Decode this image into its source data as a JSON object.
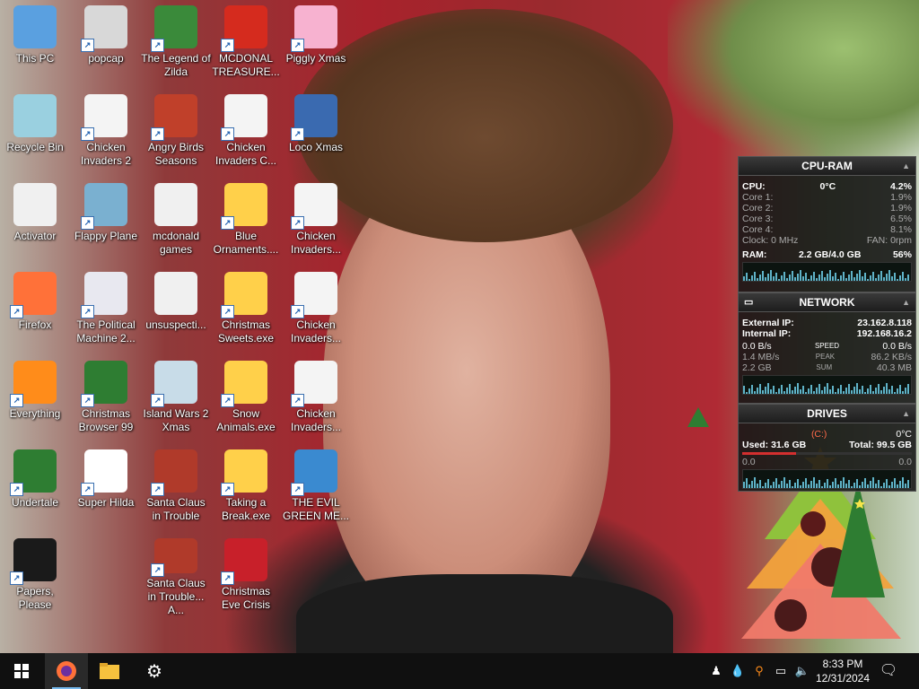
{
  "desktop": {
    "icons": [
      {
        "label": "This PC",
        "icon": "computer-icon"
      },
      {
        "label": "Recycle Bin",
        "icon": "recycle-bin-icon"
      },
      {
        "label": "Activator",
        "icon": "file-icon"
      },
      {
        "label": "Firefox",
        "icon": "firefox-icon"
      },
      {
        "label": "Everything",
        "icon": "everything-search-icon"
      },
      {
        "label": "Undertale",
        "icon": "undertale-icon"
      },
      {
        "label": "Papers, Please",
        "icon": "papers-please-icon"
      },
      {
        "label": "popcap",
        "icon": "popcap-icon"
      },
      {
        "label": "Chicken Invaders 2",
        "icon": "chicken-invaders-icon"
      },
      {
        "label": "Flappy Plane",
        "icon": "flappy-plane-icon"
      },
      {
        "label": "The Political Machine 2...",
        "icon": "political-machine-icon"
      },
      {
        "label": "Christmas Browser 99",
        "icon": "christmas-browser-icon"
      },
      {
        "label": "Super Hilda",
        "icon": "super-hilda-icon"
      },
      {
        "label": "The Legend of Zilda",
        "icon": "zilda-icon"
      },
      {
        "label": "Angry Birds Seasons",
        "icon": "angry-birds-icon"
      },
      {
        "label": "mcdonald games",
        "icon": "folder-icon"
      },
      {
        "label": "unsuspecti...",
        "icon": "file-icon"
      },
      {
        "label": "Island Wars 2 Xmas",
        "icon": "island-wars-icon"
      },
      {
        "label": "Santa Claus in Trouble",
        "icon": "santa-claus-icon"
      },
      {
        "label": "Santa Claus in Trouble... A...",
        "icon": "santa-claus-icon"
      },
      {
        "label": "MCDONAL TREASURE...",
        "icon": "mcdonalds-icon"
      },
      {
        "label": "Chicken Invaders C...",
        "icon": "chicken-invaders-icon"
      },
      {
        "label": "Blue Ornaments....",
        "icon": "exe-icon"
      },
      {
        "label": "Christmas Sweets.exe",
        "icon": "exe-icon"
      },
      {
        "label": "Snow Animals.exe",
        "icon": "exe-icon"
      },
      {
        "label": "Taking a Break.exe",
        "icon": "exe-icon"
      },
      {
        "label": "Christmas Eve Crisis",
        "icon": "christmas-eve-icon"
      },
      {
        "label": "Piggly Xmas",
        "icon": "piggly-icon"
      },
      {
        "label": "Loco Xmas",
        "icon": "loco-xmas-icon"
      },
      {
        "label": "Chicken Invaders...",
        "icon": "chicken-invaders-icon"
      },
      {
        "label": "Chicken Invaders...",
        "icon": "chicken-invaders-icon"
      },
      {
        "label": "Chicken Invaders...",
        "icon": "chicken-invaders-icon"
      },
      {
        "label": "THE EVIL GREEN ME...",
        "icon": "messenger-icon"
      }
    ]
  },
  "gadgets": {
    "cpu": {
      "title": "CPU-RAM",
      "cpu_label": "CPU:",
      "cpu_temp": "0°C",
      "cpu_pct": "4.2%",
      "cores": [
        {
          "label": "Core 1:",
          "value": "1.9%"
        },
        {
          "label": "Core 2:",
          "value": "1.9%"
        },
        {
          "label": "Core 3:",
          "value": "6.5%"
        },
        {
          "label": "Core 4:",
          "value": "8.1%"
        }
      ],
      "clock_label": "Clock: 0 MHz",
      "fan_label": "FAN: 0rpm",
      "ram_label": "RAM:",
      "ram_value": "2.2 GB/4.0 GB",
      "ram_pct": "56%"
    },
    "network": {
      "title": "NETWORK",
      "external_label": "External IP:",
      "external_ip": "23.162.8.118",
      "internal_label": "Internal IP:",
      "internal_ip": "192.168.16.2",
      "speed_down": "0.0 B/s",
      "speed_label": "SPEED",
      "speed_up": "0.0 B/s",
      "peak_down": "1.4 MB/s",
      "peak_label": "PEAK",
      "peak_up": "86.2 KB/s",
      "sum_down": "2.2 GB",
      "sum_label": "SUM",
      "sum_up": "40.3 MB"
    },
    "drives": {
      "title": "DRIVES",
      "drive": "(C:)",
      "temp": "0°C",
      "used_label": "Used: 31.6 GB",
      "total_label": "Total: 99.5 GB",
      "read": "0.0",
      "write": "0.0"
    }
  },
  "taskbar": {
    "pinned": [
      {
        "name": "start-button",
        "icon": "windows-logo-icon"
      },
      {
        "name": "firefox-taskbar",
        "icon": "firefox-icon"
      },
      {
        "name": "file-explorer-taskbar",
        "icon": "folder-icon"
      },
      {
        "name": "settings-taskbar",
        "icon": "gear-icon"
      }
    ],
    "time": "8:33 PM",
    "date": "12/31/2024"
  },
  "colors": {
    "taskbar": "#101010",
    "gadget_bg": "#141414",
    "graph_line": "#5fb3c8",
    "accent_red": "#d32f2f"
  }
}
